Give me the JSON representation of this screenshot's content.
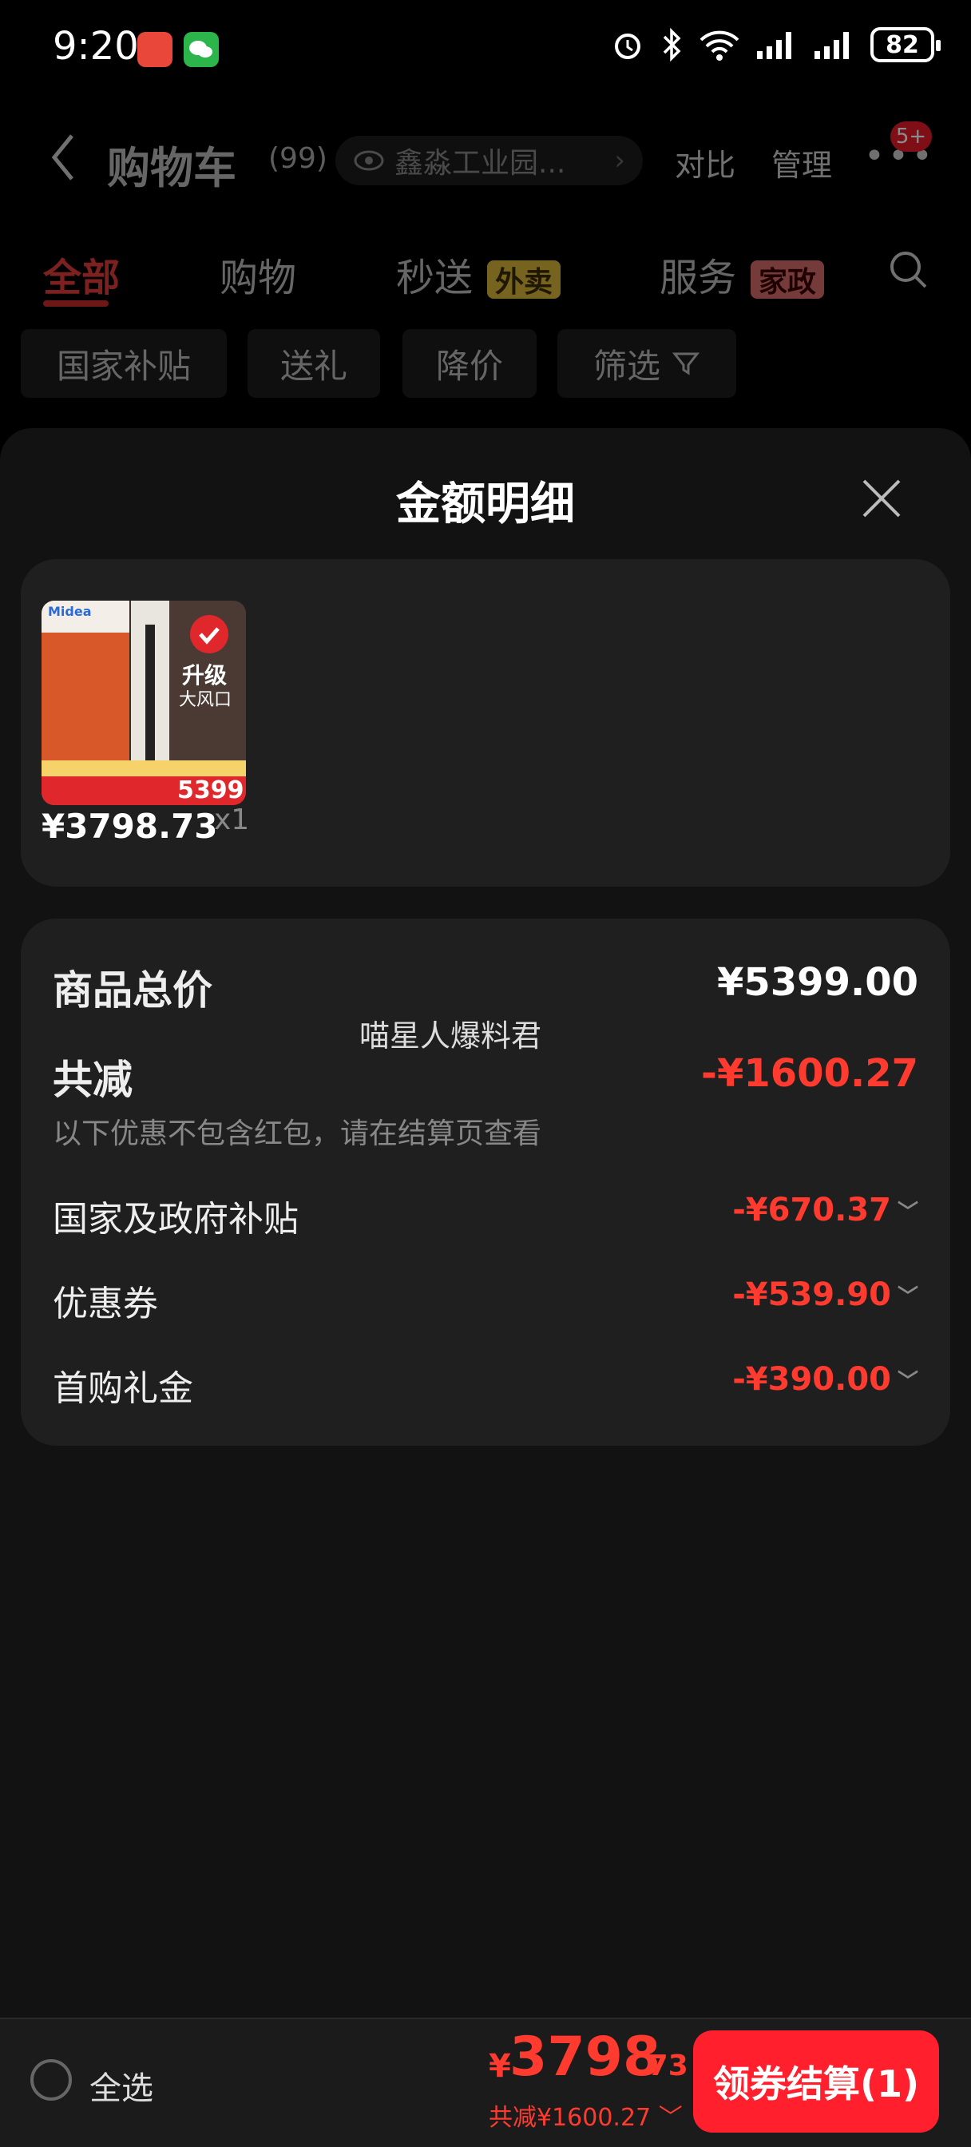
{
  "status_bar": {
    "time": "9:20",
    "battery": "82"
  },
  "header": {
    "title": "购物车",
    "count": "(99)",
    "address": "鑫淼工业园...",
    "compare": "对比",
    "manage": "管理",
    "more_badge": "5+"
  },
  "tabs": [
    {
      "label": "全部"
    },
    {
      "label": "购物"
    },
    {
      "label": "秒送",
      "tag": "外卖"
    },
    {
      "label": "服务",
      "tag": "家政"
    }
  ],
  "filters": [
    "国家补贴",
    "送礼",
    "降价",
    "筛选"
  ],
  "sheet": {
    "title": "金额明细",
    "product": {
      "brand": "Midea",
      "img_text_main": "升级",
      "img_text_sub": "大风口",
      "img_price": "5399",
      "price": "¥3798.73",
      "qty": "x1"
    },
    "summary": {
      "total_label": "商品总价",
      "total_value": "¥5399.00",
      "discount_label": "共减",
      "discount_value": "-¥1600.27",
      "note": "以下优惠不包含红包，请在结算页查看",
      "items": [
        {
          "label": "国家及政府补贴",
          "value": "-¥670.37"
        },
        {
          "label": "优惠券",
          "value": "-¥539.90"
        },
        {
          "label": "首购礼金",
          "value": "-¥390.00"
        }
      ]
    },
    "watermark": "喵星人爆料君"
  },
  "bottom_bar": {
    "select_all": "全选",
    "yen": "¥",
    "total_int": "3798",
    "total_dec": ".73",
    "total_sub": "共减¥1600.27",
    "checkout": "领券结算(1)"
  },
  "colors": {
    "accent_red": "#ff3b30",
    "button_red": "#ff1f2d",
    "background": "#000000",
    "card": "#1f1f1f"
  }
}
